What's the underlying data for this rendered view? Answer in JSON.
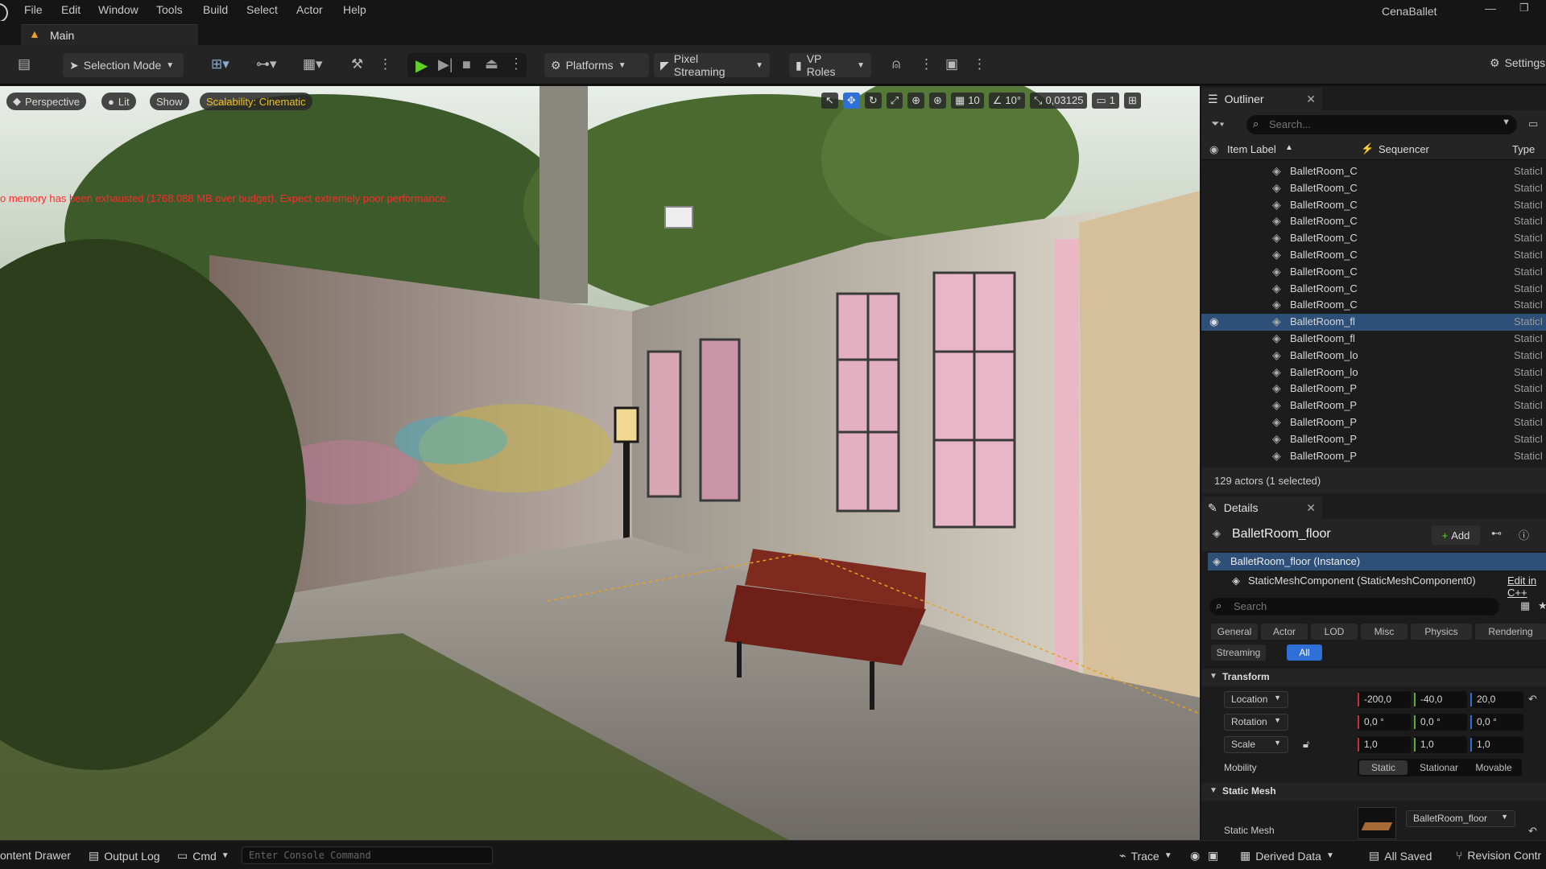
{
  "menu": {
    "items": [
      "File",
      "Edit",
      "Window",
      "Tools",
      "Build",
      "Select",
      "Actor",
      "Help"
    ],
    "project": "CenaBallet"
  },
  "tab": {
    "label": "Main"
  },
  "toolbar": {
    "selection_mode": "Selection Mode",
    "platforms": "Platforms",
    "pixel_streaming": "Pixel Streaming",
    "vp_roles": "VP Roles",
    "settings": "Settings"
  },
  "viewport": {
    "perspective": "Perspective",
    "lit": "Lit",
    "show": "Show",
    "scalability": "Scalability: Cinematic",
    "warning": "o memory has been exhausted (1768.088 MB over budget). Expect extremely poor performance.",
    "grid_snap": "10",
    "rot_snap": "10°",
    "scale_snap": "0,03125",
    "cam_speed": "1"
  },
  "outliner": {
    "title": "Outliner",
    "search_placeholder": "Search...",
    "col_label": "Item Label",
    "col_sequencer": "Sequencer",
    "col_type": "Type",
    "rows": [
      {
        "label": "BalletRoom_C",
        "type": "StaticI"
      },
      {
        "label": "BalletRoom_C",
        "type": "StaticI"
      },
      {
        "label": "BalletRoom_C",
        "type": "StaticI"
      },
      {
        "label": "BalletRoom_C",
        "type": "StaticI"
      },
      {
        "label": "BalletRoom_C",
        "type": "StaticI"
      },
      {
        "label": "BalletRoom_C",
        "type": "StaticI"
      },
      {
        "label": "BalletRoom_C",
        "type": "StaticI"
      },
      {
        "label": "BalletRoom_C",
        "type": "StaticI"
      },
      {
        "label": "BalletRoom_C",
        "type": "StaticI"
      },
      {
        "label": "BalletRoom_fl",
        "type": "StaticI",
        "selected": true
      },
      {
        "label": "BalletRoom_fl",
        "type": "StaticI"
      },
      {
        "label": "BalletRoom_lo",
        "type": "StaticI"
      },
      {
        "label": "BalletRoom_lo",
        "type": "StaticI"
      },
      {
        "label": "BalletRoom_P",
        "type": "StaticI"
      },
      {
        "label": "BalletRoom_P",
        "type": "StaticI"
      },
      {
        "label": "BalletRoom_P",
        "type": "StaticI"
      },
      {
        "label": "BalletRoom_P",
        "type": "StaticI"
      },
      {
        "label": "BalletRoom_P",
        "type": "StaticI"
      }
    ],
    "status": "129 actors (1 selected)"
  },
  "details": {
    "title": "Details",
    "actor_name": "BalletRoom_floor",
    "add_label": "Add",
    "instance": "BalletRoom_floor (Instance)",
    "component": "StaticMeshComponent (StaticMeshComponent0)",
    "edit_cpp": "Edit in C++",
    "search_placeholder": "Search",
    "categories": [
      "General",
      "Actor",
      "LOD",
      "Misc",
      "Physics",
      "Rendering",
      "Streaming",
      "All"
    ],
    "transform_header": "Transform",
    "location_label": "Location",
    "location": [
      "-200,0",
      "-40,0",
      "20,0"
    ],
    "rotation_label": "Rotation",
    "rotation": [
      "0,0 °",
      "0,0 °",
      "0,0 °"
    ],
    "scale_label": "Scale",
    "scale": [
      "1,0",
      "1,0",
      "1,0"
    ],
    "mobility_label": "Mobility",
    "mobility": [
      "Static",
      "Stationar",
      "Movable"
    ],
    "static_mesh_header": "Static Mesh",
    "static_mesh_label": "Static Mesh",
    "static_mesh_value": "BalletRoom_floor"
  },
  "statusbar": {
    "content_drawer": "ontent Drawer",
    "output_log": "Output Log",
    "cmd": "Cmd",
    "console_placeholder": "Enter Console Command",
    "trace": "Trace",
    "derived_data": "Derived Data",
    "all_saved": "All Saved",
    "revision_control": "Revision Contr"
  },
  "colors": {
    "accent": "#2f6fd8",
    "selected_row": "#2d4f78",
    "play": "#5fd02a",
    "warning_red": "#ff2b2b",
    "scalability": "#f0c020"
  }
}
